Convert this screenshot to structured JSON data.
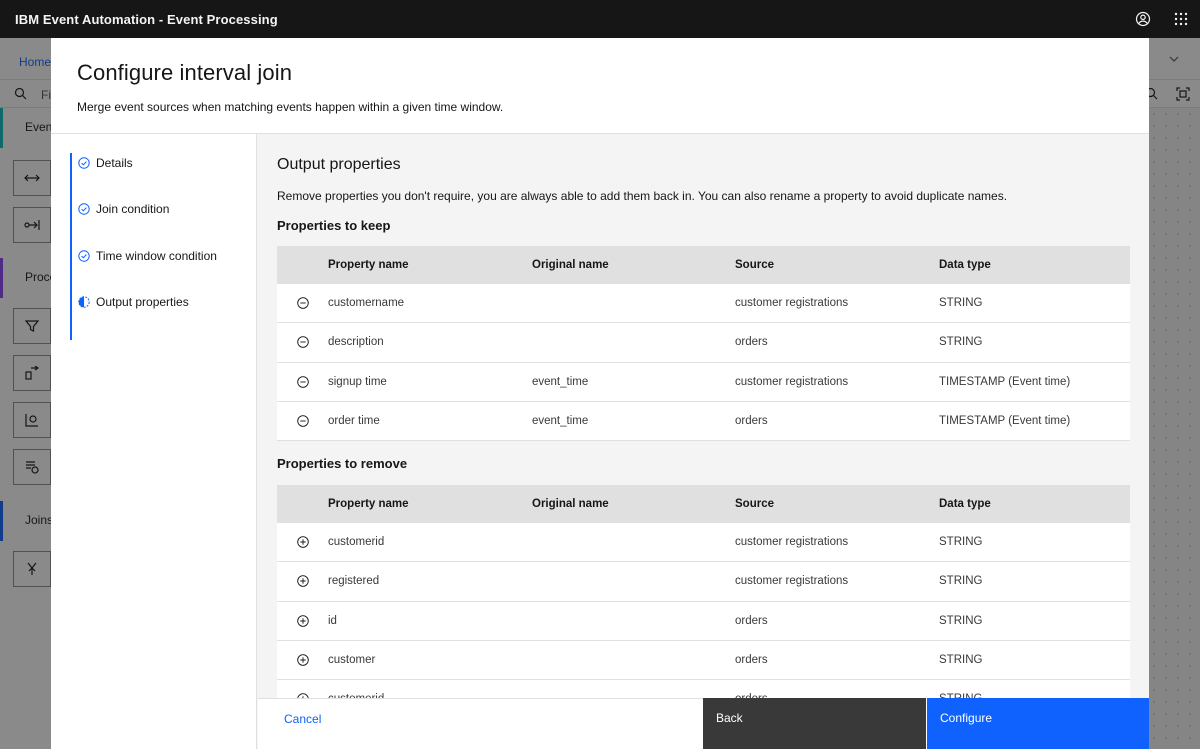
{
  "app": {
    "title": "IBM Event Automation - Event Processing"
  },
  "background": {
    "breadcrumb_home": "Home",
    "search_placeholder": "Fi",
    "palette": {
      "events_label": "Even",
      "processors_label": "Proce",
      "joins_label": "Joins"
    }
  },
  "modal": {
    "title": "Configure interval join",
    "subtitle": "Merge event sources when matching events happen within a given time window.",
    "steps": [
      {
        "label": "Details",
        "status": "complete"
      },
      {
        "label": "Join condition",
        "status": "complete"
      },
      {
        "label": "Time window condition",
        "status": "complete"
      },
      {
        "label": "Output properties",
        "status": "current"
      }
    ],
    "section_title": "Output properties",
    "section_description": "Remove properties you don't require, you are always able to add them back in. You can also rename a property to avoid duplicate names.",
    "columns": [
      "Property name",
      "Original name",
      "Source",
      "Data type"
    ],
    "keep": {
      "caption": "Properties to keep",
      "rows": [
        {
          "name": "customername",
          "original": "",
          "source": "customer registrations",
          "type": "STRING"
        },
        {
          "name": "description",
          "original": "",
          "source": "orders",
          "type": "STRING"
        },
        {
          "name": "signup time",
          "original": "event_time",
          "source": "customer registrations",
          "type": "TIMESTAMP (Event time)"
        },
        {
          "name": "order time",
          "original": "event_time",
          "source": "orders",
          "type": "TIMESTAMP (Event time)"
        }
      ]
    },
    "remove": {
      "caption": "Properties to remove",
      "rows": [
        {
          "name": "customerid",
          "original": "",
          "source": "customer registrations",
          "type": "STRING"
        },
        {
          "name": "registered",
          "original": "",
          "source": "customer registrations",
          "type": "STRING"
        },
        {
          "name": "id",
          "original": "",
          "source": "orders",
          "type": "STRING"
        },
        {
          "name": "customer",
          "original": "",
          "source": "orders",
          "type": "STRING"
        },
        {
          "name": "customerid",
          "original": "",
          "source": "orders",
          "type": "STRING"
        }
      ]
    },
    "buttons": {
      "cancel": "Cancel",
      "back": "Back",
      "configure": "Configure"
    }
  },
  "colors": {
    "primary": "#0f62fe",
    "header": "#161616",
    "secondary_button": "#393939"
  }
}
